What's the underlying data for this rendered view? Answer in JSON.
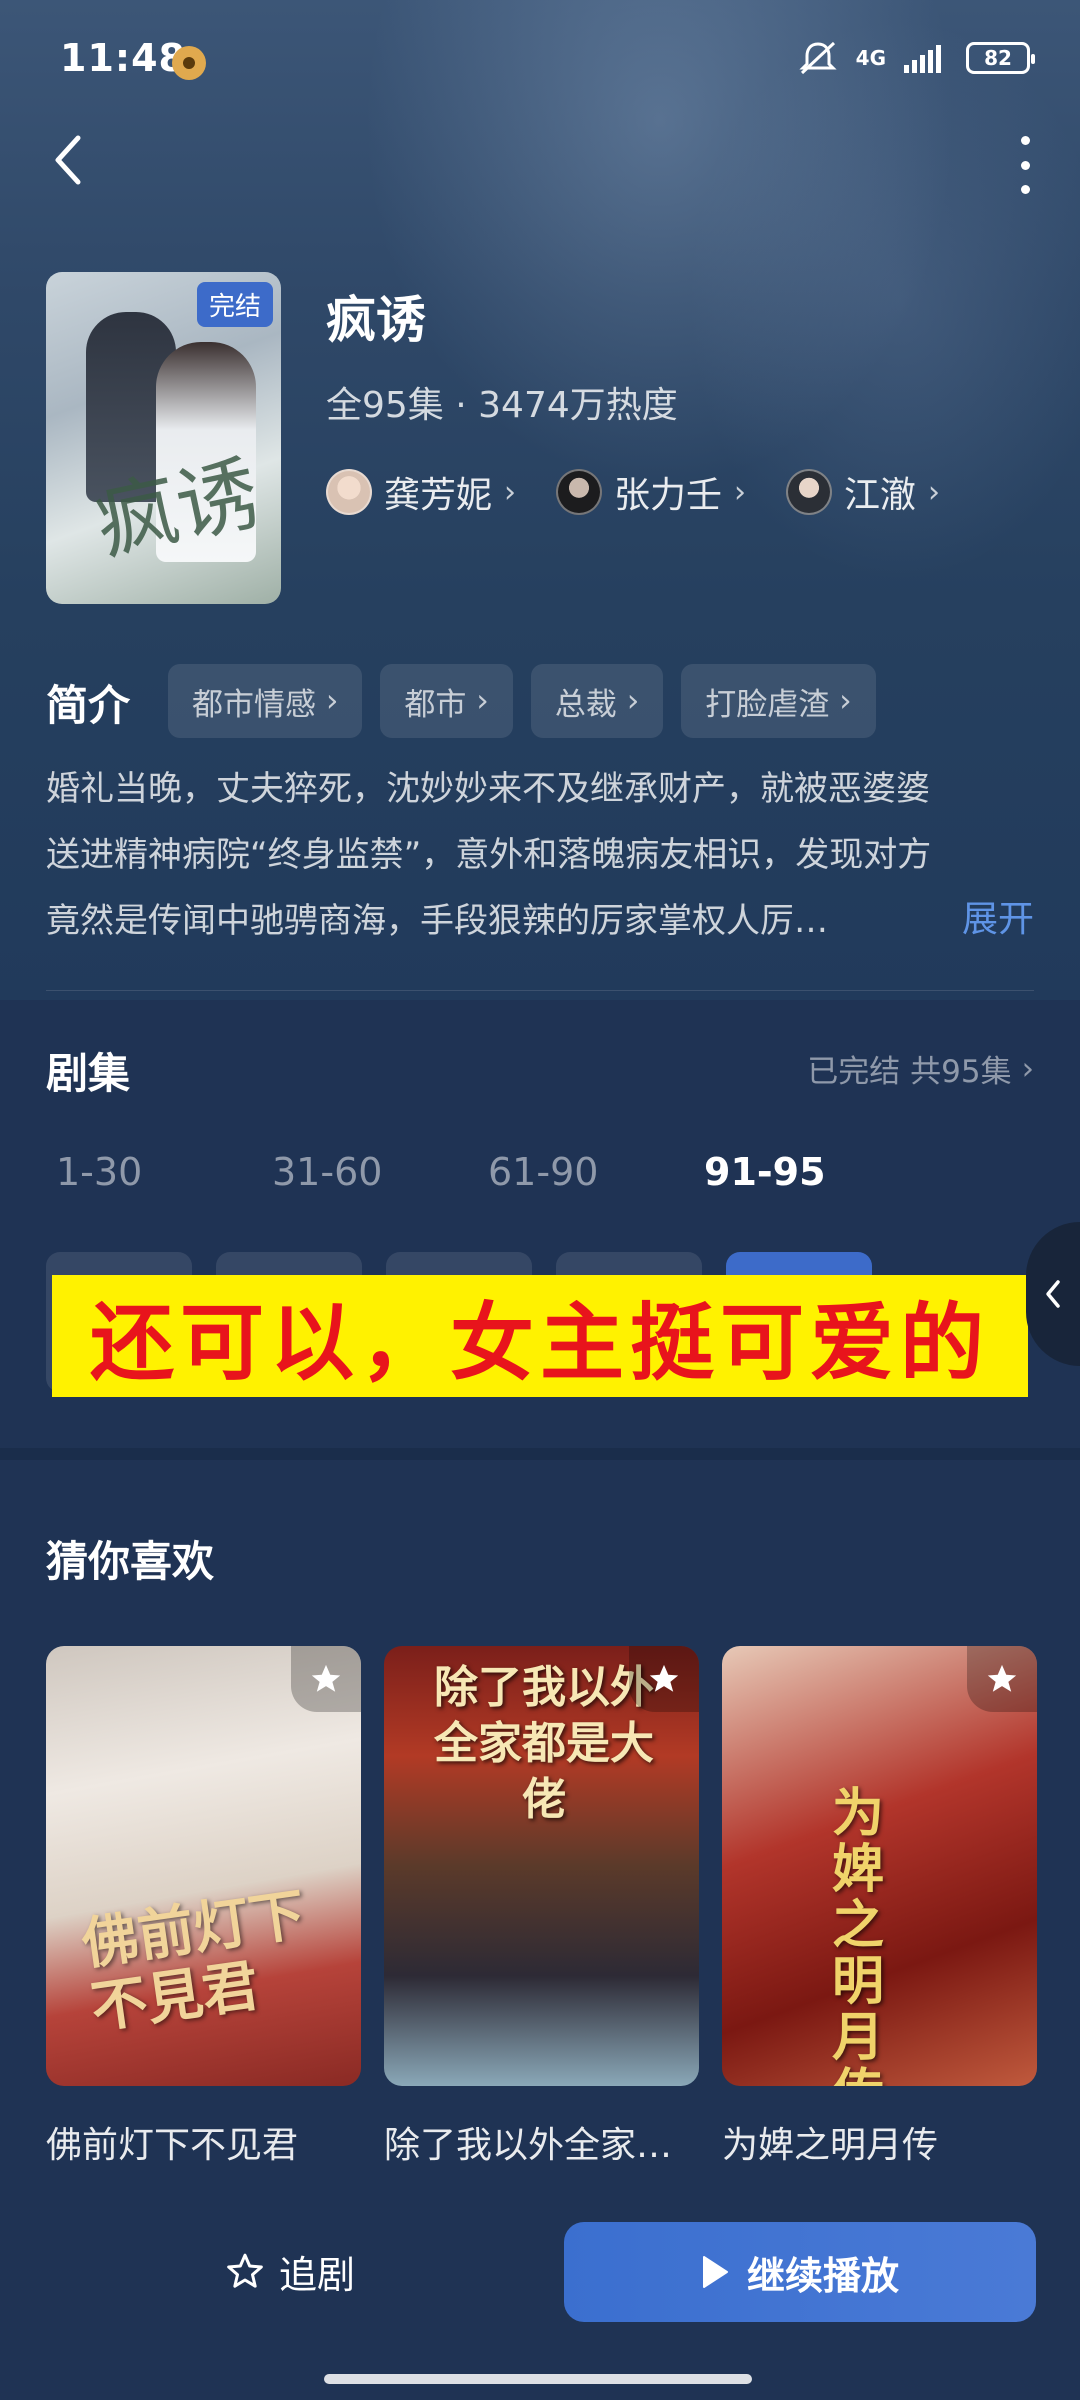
{
  "status_bar": {
    "time": "11:48",
    "network": "4G",
    "battery": "82"
  },
  "drama": {
    "title": "疯诱",
    "poster_tag": "完结",
    "poster_text": "疯诱",
    "meta": "全95集 · 3474万热度",
    "cast": [
      {
        "name": "龚芳妮"
      },
      {
        "name": "张力壬"
      },
      {
        "name": "江澈"
      }
    ]
  },
  "intro": {
    "label": "简介",
    "tags": [
      "都市情感",
      "都市",
      "总裁",
      "打脸虐渣"
    ],
    "lines": [
      "婚礼当晚，丈夫猝死，沈妙妙来不及继承财产，就被恶婆婆",
      "送进精神病院“终身监禁”，意外和落魄病友相识，发现对方",
      "竟然是传闻中驰骋商海，手段狠辣的厉家掌权人厉…"
    ],
    "expand": "展开"
  },
  "episodes": {
    "label": "剧集",
    "status": "已完结 共95集",
    "ranges": [
      "1-30",
      "31-60",
      "61-90",
      "91-95"
    ],
    "active_range": 3
  },
  "caption": "还可以，女主挺可爱的",
  "recommend": {
    "label": "猜你喜欢",
    "items": [
      {
        "name": "佛前灯下不见君",
        "poster_text": "佛前灯下不見君"
      },
      {
        "name": "除了我以外全家都是大佬",
        "poster_text": "除了我以外全家都是大佬"
      },
      {
        "name": "为婢之明月传",
        "poster_text": "为婢之明月传"
      }
    ]
  },
  "bottom_bar": {
    "follow": "追剧",
    "play": "继续播放"
  },
  "colors": {
    "accent": "#3d6bc9",
    "link": "#5f94e6",
    "caption_bg": "#fff200",
    "caption_text": "#e8141c"
  }
}
